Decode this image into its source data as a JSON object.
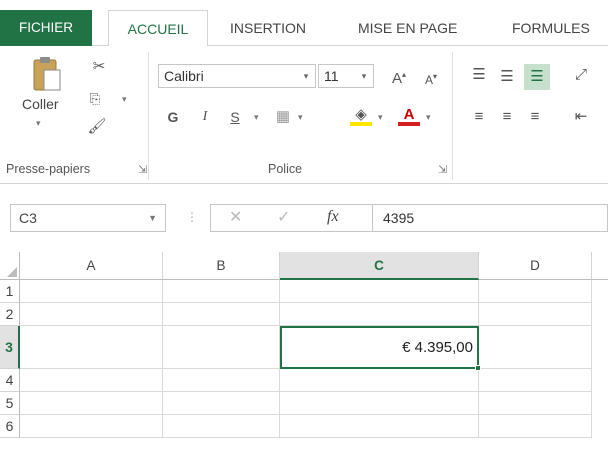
{
  "tabs": {
    "file": "FICHIER",
    "home": "ACCUEIL",
    "insert": "INSERTION",
    "layout": "MISE EN PAGE",
    "formulas": "FORMULES"
  },
  "ribbon": {
    "clipboard": {
      "paste_label": "Coller",
      "group_label": "Presse-papiers"
    },
    "font": {
      "font_name": "Calibri",
      "font_size": "11",
      "bold": "G",
      "italic": "I",
      "underline": "S",
      "group_label": "Police"
    }
  },
  "formula_bar": {
    "name_box": "C3",
    "fx_label": "fx",
    "value": "4395"
  },
  "sheet": {
    "columns": [
      "A",
      "B",
      "C",
      "D"
    ],
    "rows": [
      "1",
      "2",
      "3",
      "4",
      "5",
      "6"
    ],
    "cell_c3": "€ 4.395,00"
  },
  "colors": {
    "accent": "#217346"
  }
}
